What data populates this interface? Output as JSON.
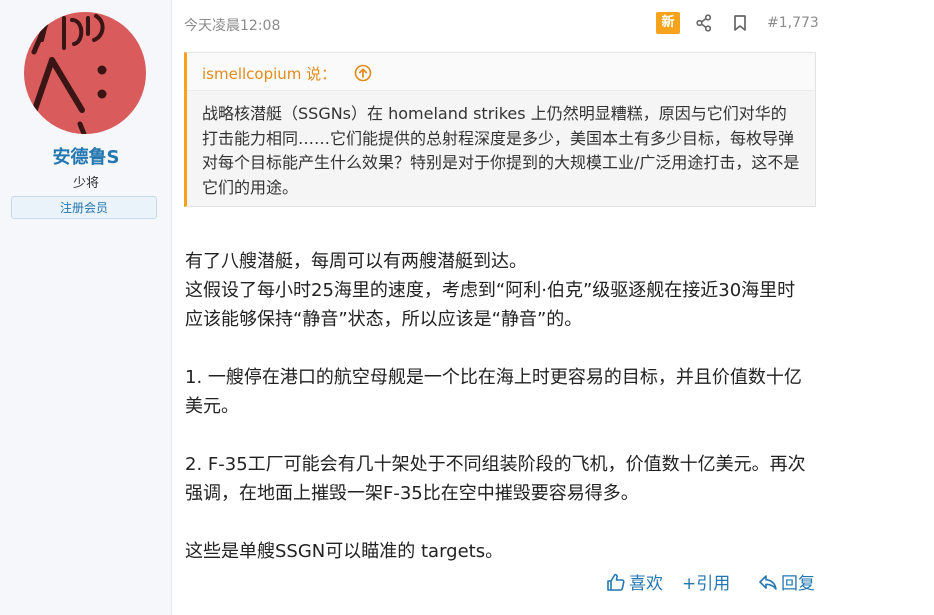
{
  "user": {
    "name": "安德鲁S",
    "title": "少将",
    "banner": "注册会员",
    "avatar_color": "#d95b5b"
  },
  "post": {
    "timestamp": "今天凌晨12:08",
    "new_badge": "新",
    "post_number": "#1,773",
    "badge_color": "#f7a21b",
    "quote": {
      "author": "ismellcopium 说：",
      "text": "战略核潜艇（SSGNs）在 homeland strikes 上仍然明显糟糕，原因与它们对华的打击能力相同……它们能提供的总射程深度是多少，美国本土有多少目标，每枚导弹对每个目标能产生什么效果？特别是对于你提到的大规模工业/广泛用途打击，这不是它们的用途。"
    },
    "body": {
      "p1": "有了八艘潜艇，每周可以有两艘潜艇到达。",
      "p2": "这假设了每小时25海里的速度，考虑到“阿利·伯克”级驱逐舰在接近30海里时应该能够保持“静音”状态，所以应该是“静音”的。",
      "p3": "1. 一艘停在港口的航空母舰是一个比在海上时更容易的目标，并且价值数十亿美元。",
      "p4": "2. F-35工厂可能会有几十架处于不同组装阶段的飞机，价值数十亿美元。再次强调，在地面上摧毁一架F-35比在空中摧毁要容易得多。",
      "p5": "这些是单艘SSGN可以瞄准的 targets。"
    },
    "actions": {
      "like": "喜欢",
      "quote": "+引用",
      "reply": "回复"
    },
    "icons": {
      "share": "share-icon",
      "bookmark": "bookmark-icon",
      "up": "arrow-up-circle-icon",
      "like": "thumbs-up-icon",
      "reply": "reply-icon"
    }
  }
}
